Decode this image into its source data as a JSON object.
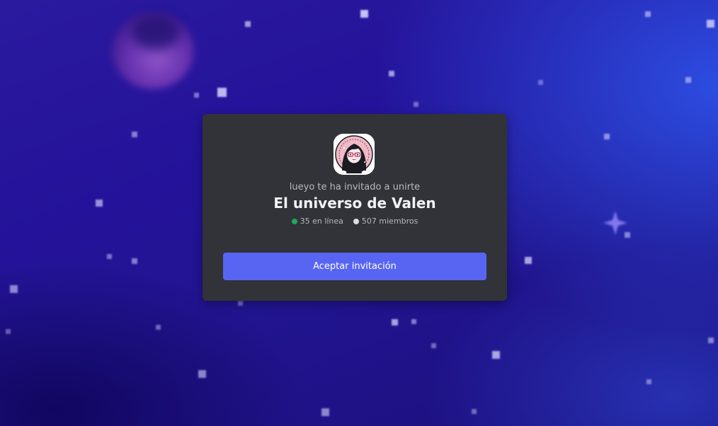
{
  "invite": {
    "inviter_text": "lueyo te ha invitado a unirte",
    "server_name": "El universo de Valen",
    "online_count": "35 en línea",
    "member_count": "507 miembros",
    "accept_label": "Aceptar invitación"
  },
  "icons": {
    "server": "server-avatar-icon",
    "online": "online-status-dot",
    "members": "members-status-dot"
  },
  "colors": {
    "card_background": "#313338",
    "accent_button": "#5865f2",
    "online_green": "#23a55a",
    "members_gray": "#dbdee1",
    "title_text": "#f2f3f5",
    "muted_text": "#b5bac1"
  }
}
